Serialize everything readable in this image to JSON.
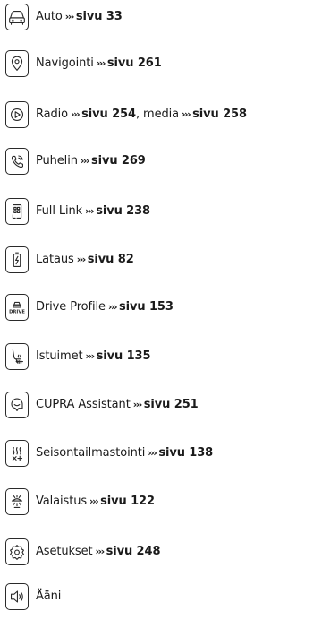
{
  "items": [
    {
      "icon": "car-icon",
      "text": "Auto",
      "refs": [
        "sivu 33"
      ],
      "sep": "",
      "extra": ""
    },
    {
      "icon": "location-pin-icon",
      "text": "Navigointi",
      "refs": [
        "sivu 261"
      ],
      "sep": "",
      "extra": ""
    },
    {
      "icon": "play-icon",
      "text": "Radio",
      "refs": [
        "sivu 254",
        "sivu 258"
      ],
      "sep": ", ",
      "extra": "media"
    },
    {
      "icon": "phone-icon",
      "text": "Puhelin",
      "refs": [
        "sivu 269"
      ],
      "sep": "",
      "extra": ""
    },
    {
      "icon": "phone-link-icon",
      "text": "Full Link",
      "refs": [
        "sivu 238"
      ],
      "sep": "",
      "extra": ""
    },
    {
      "icon": "battery-charge-icon",
      "text": "Lataus",
      "refs": [
        "sivu 82"
      ],
      "sep": "",
      "extra": ""
    },
    {
      "icon": "drive-profile-icon",
      "text": "Drive Profile",
      "refs": [
        "sivu 153"
      ],
      "sep": "",
      "extra": ""
    },
    {
      "icon": "seat-heating-icon",
      "text": "Istuimet",
      "refs": [
        "sivu 135"
      ],
      "sep": "",
      "extra": ""
    },
    {
      "icon": "assistant-icon",
      "text": "CUPRA Assistant",
      "refs": [
        "sivu 251"
      ],
      "sep": "",
      "extra": ""
    },
    {
      "icon": "climate-control-icon",
      "text": "Seisontailmastointi",
      "refs": [
        "sivu 138"
      ],
      "sep": "",
      "extra": ""
    },
    {
      "icon": "lighting-icon",
      "text": "Valaistus",
      "refs": [
        "sivu 122"
      ],
      "sep": "",
      "extra": ""
    },
    {
      "icon": "settings-gear-icon",
      "text": "Asetukset",
      "refs": [
        "sivu 248"
      ],
      "sep": "",
      "extra": ""
    },
    {
      "icon": "speaker-icon",
      "text": "Ääni",
      "refs": [],
      "sep": "",
      "extra": ""
    }
  ],
  "arrow_glyph": "›››",
  "drive_badge_text": "DRIVE"
}
